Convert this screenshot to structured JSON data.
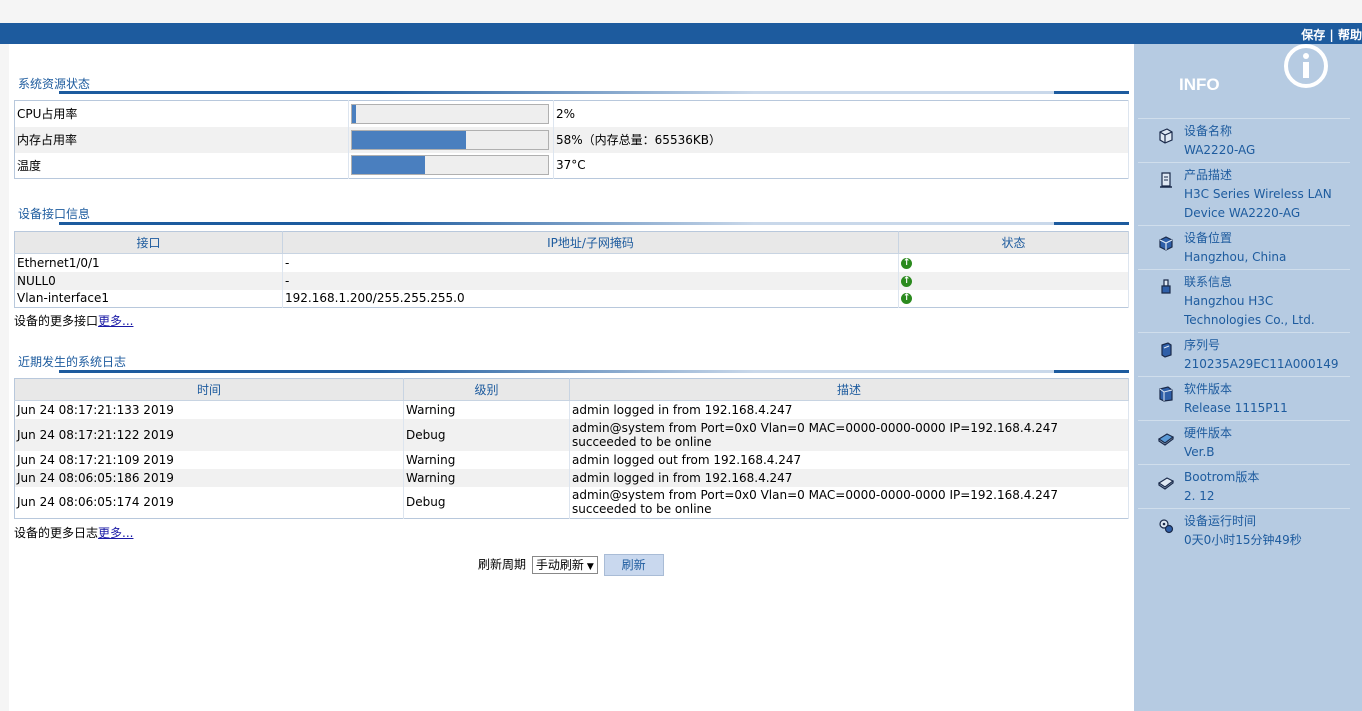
{
  "header": {
    "save_label": "保存",
    "separator": "|",
    "help_label": "帮助"
  },
  "resources": {
    "title": "系统资源状态",
    "rows": [
      {
        "label": "CPU占用率",
        "percent": 2,
        "value": "2%"
      },
      {
        "label": "内存占用率",
        "percent": 58,
        "value": "58%（内存总量：65536KB）"
      },
      {
        "label": "温度",
        "percent": 37,
        "value": "37°C"
      }
    ]
  },
  "interfaces": {
    "title": "设备接口信息",
    "headers": [
      "接口",
      "IP地址/子网掩码",
      "状态"
    ],
    "rows": [
      {
        "name": "Ethernet1/0/1",
        "ip": "-",
        "status": "up"
      },
      {
        "name": "NULL0",
        "ip": "-",
        "status": "up"
      },
      {
        "name": "Vlan-interface1",
        "ip": "192.168.1.200/255.255.255.0",
        "status": "up"
      }
    ],
    "more_text": "设备的更多接口",
    "more_link": "更多..."
  },
  "logs": {
    "title": "近期发生的系统日志",
    "headers": [
      "时间",
      "级别",
      "描述"
    ],
    "rows": [
      {
        "time": "Jun 24 08:17:21:133 2019",
        "level": "Warning",
        "desc": "admin logged in from 192.168.4.247"
      },
      {
        "time": "Jun 24 08:17:21:122 2019",
        "level": "Debug",
        "desc": "admin@system from Port=0x0 Vlan=0 MAC=0000-0000-0000 IP=192.168.4.247 succeeded to be online"
      },
      {
        "time": "Jun 24 08:17:21:109 2019",
        "level": "Warning",
        "desc": "admin logged out from 192.168.4.247"
      },
      {
        "time": "Jun 24 08:06:05:186 2019",
        "level": "Warning",
        "desc": "admin logged in from 192.168.4.247"
      },
      {
        "time": "Jun 24 08:06:05:174 2019",
        "level": "Debug",
        "desc": "admin@system from Port=0x0 Vlan=0 MAC=0000-0000-0000 IP=192.168.4.247 succeeded to be online"
      }
    ],
    "more_text": "设备的更多日志",
    "more_link": "更多..."
  },
  "refresh": {
    "label": "刷新周期",
    "selected": "手动刷新",
    "button": "刷新"
  },
  "info": {
    "title": "INFO",
    "items": [
      {
        "label": "设备名称",
        "value": "WA2220-AG",
        "icon": "device-icon"
      },
      {
        "label": "产品描述",
        "value": "H3C Series Wireless LAN Device WA2220-AG",
        "icon": "description-icon"
      },
      {
        "label": "设备位置",
        "value": "Hangzhou, China",
        "icon": "location-icon"
      },
      {
        "label": "联系信息",
        "value": "Hangzhou H3C Technologies Co., Ltd.",
        "icon": "contact-icon"
      },
      {
        "label": "序列号",
        "value": "210235A29EC11A000149",
        "icon": "serial-icon"
      },
      {
        "label": "软件版本",
        "value": "Release 1115P11",
        "icon": "software-icon"
      },
      {
        "label": "硬件版本",
        "value": "Ver.B",
        "icon": "hardware-icon"
      },
      {
        "label": "Bootrom版本",
        "value": "2. 12",
        "icon": "bootrom-icon"
      },
      {
        "label": "设备运行时间",
        "value": "0天0小时15分钟49秒",
        "icon": "uptime-icon"
      }
    ]
  }
}
